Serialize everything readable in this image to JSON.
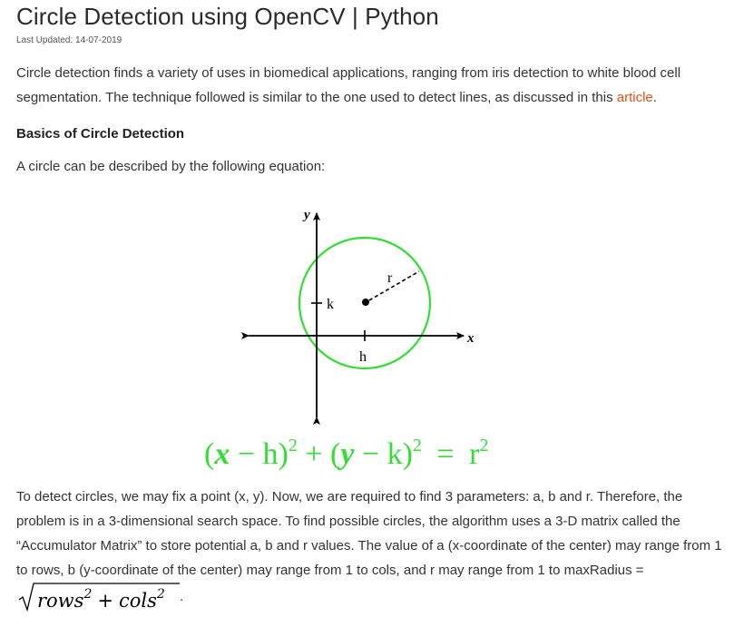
{
  "article": {
    "title": "Circle Detection using OpenCV | Python",
    "last_updated": "Last Updated: 14-07-2019",
    "intro_text": "Circle detection finds a variety of uses in biomedical applications, ranging from iris detection to white blood cell segmentation. The technique followed is similar to the one used to detect lines, as discussed in this ",
    "intro_link": "article",
    "intro_end": ".",
    "section_heading": "Basics of Circle Detection",
    "equation_intro": "A circle can be described by the following equation:",
    "body_text": "To detect circles, we may fix a point (x, y). Now, we are required to find 3 parameters: a, b and r. Therefore, the problem is in a 3-dimensional search space. To find possible circles, the algorithm uses a 3-D matrix called the “Accumulator Matrix” to store potential a, b and r values. The value of a (x-coordinate of the center) may range from 1 to rows, b (y-coordinate of the center) may range from 1 to cols, and r may range from 1 to maxRadius = ",
    "body_end": "."
  },
  "diagram": {
    "label_y": "y",
    "label_x": "x",
    "label_k": "k",
    "label_h": "h",
    "label_r": "r",
    "circle_color": "#33dd33",
    "equation": {
      "open1": "(",
      "var_x": "x",
      "minus1": " − h)",
      "exp1": "2",
      "plus": " + (",
      "var_y": "y",
      "minus2": " − k)",
      "exp2": "2",
      "equals": " = ",
      "r": "r",
      "exp3": "2",
      "color": "#33dd33"
    }
  },
  "formula": {
    "rows": "rows",
    "cols": "cols",
    "plus": "+",
    "exp": "2"
  },
  "colors": {
    "text": "#333333",
    "link": "#e2531e",
    "equation_green": "#33dd33"
  }
}
